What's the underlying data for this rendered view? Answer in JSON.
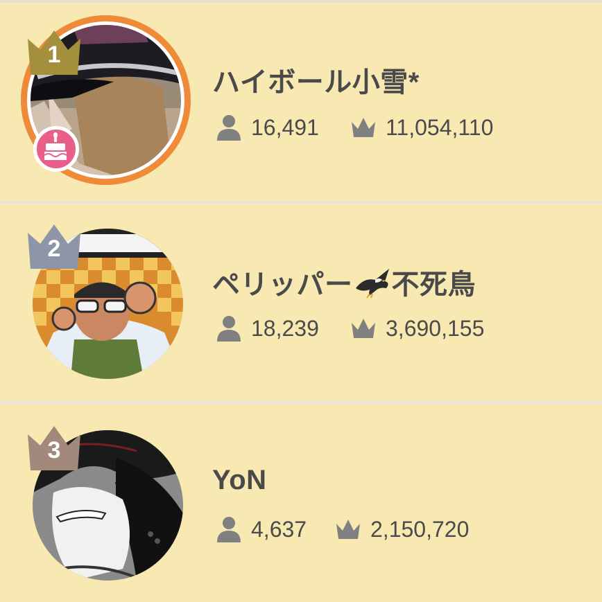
{
  "ranking": [
    {
      "rank": "1",
      "name": "ハイボール小雪*",
      "followers": "16,491",
      "points": "11,054,110",
      "crown_color": "#a48f3c",
      "has_birthday_badge": true,
      "has_ring": true
    },
    {
      "rank": "2",
      "name_text": "ペリッパー",
      "name_emoji": "eagle-emoji",
      "name_suffix": "不死鳥",
      "followers": "18,239",
      "points": "3,690,155",
      "crown_color": "#8d96a8",
      "has_birthday_badge": false,
      "has_ring": false
    },
    {
      "rank": "3",
      "name": "YoN",
      "followers": "4,637",
      "points": "2,150,720",
      "crown_color": "#a3897c",
      "has_birthday_badge": false,
      "has_ring": false
    }
  ],
  "colors": {
    "background": "#f8e8b2",
    "separator": "#e9e4d6",
    "ring": "#ee8a38",
    "text": "#4a4a4a",
    "icon": "#808080",
    "badge": "#e8608a"
  },
  "icons": {
    "followers": "person-icon",
    "points": "crown-icon",
    "badge": "birthday-cake-icon"
  }
}
